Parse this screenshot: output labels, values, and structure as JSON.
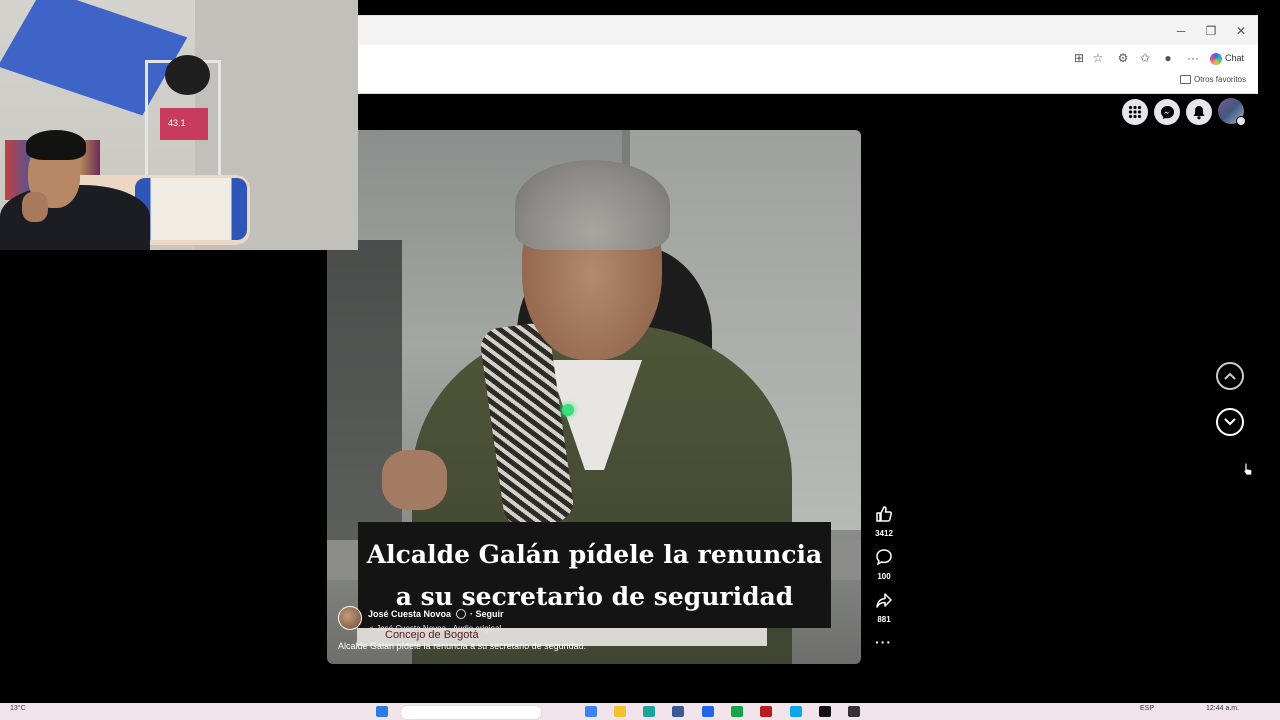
{
  "browser": {
    "minimize_icon": "minimize-icon",
    "maximize_icon": "maximize-icon",
    "close_icon": "close-icon",
    "chat_label": "Chat",
    "favorites_folder": "Otros favoritos"
  },
  "post": {
    "caption_line1": "Alcalde Galán pídele la renuncia",
    "caption_line2": "a su secretario de seguridad",
    "author": "José Cuesta Novoa",
    "follow": "· Seguir",
    "audio": "José Cuesta Novoa · Audio original",
    "sign_text": "Concejo de Bogotá",
    "description": "Alcalde Galán pídele la renuncia a su secretario de seguridad."
  },
  "actions": {
    "likes": "3412",
    "comments": "100",
    "shares": "881"
  },
  "webcam": {
    "box_label": "43.1"
  },
  "taskbar": {
    "weather": "13°C",
    "language": "ESP",
    "time": "12:44 a.m."
  },
  "colors": {
    "background": "#000000",
    "chrome": "#f3f3f3",
    "taskbar": "#f0e4ea",
    "caption_bg": "#141414",
    "facebook_button": "#e4e6eb"
  }
}
